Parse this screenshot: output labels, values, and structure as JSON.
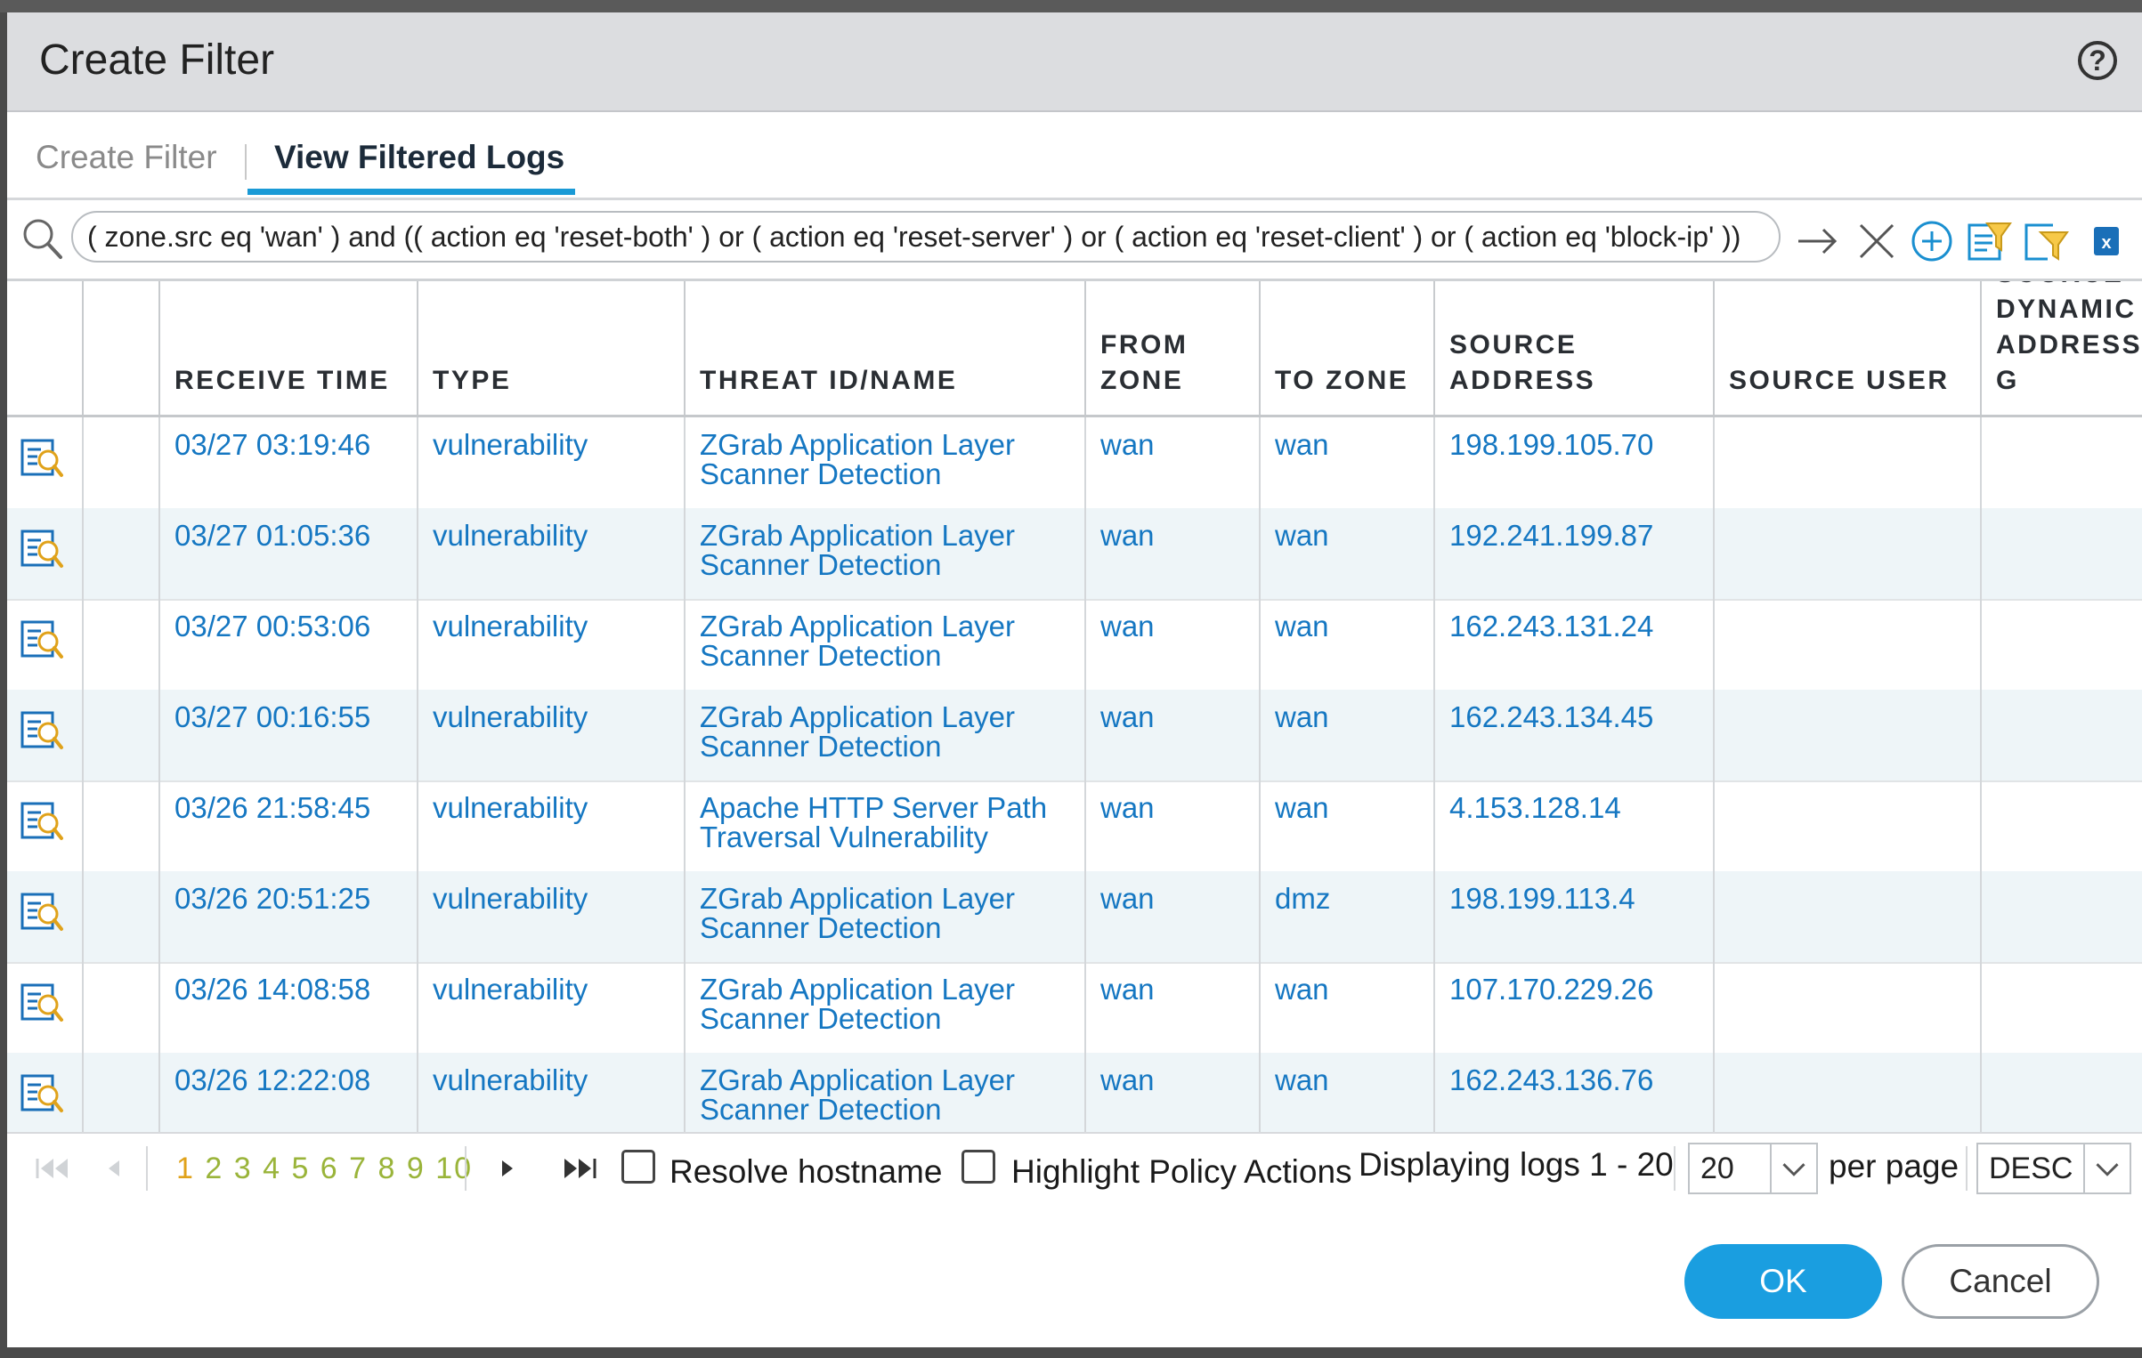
{
  "dialog": {
    "title": "Create Filter",
    "help_icon": "question-circle-icon"
  },
  "tabs": [
    {
      "label": "Create Filter",
      "active": false
    },
    {
      "label": "View Filtered Logs",
      "active": true
    }
  ],
  "search": {
    "filter_text": "( zone.src eq 'wan' )  and (( action eq 'reset-both' ) or ( action eq 'reset-server' ) or ( action eq 'reset-client' ) or ( action eq 'block-ip' ))",
    "icons": [
      "search-icon",
      "apply-filter-arrow-icon",
      "clear-filter-icon",
      "add-filter-icon",
      "save-filter-icon",
      "load-filter-icon",
      "export-excel-icon"
    ]
  },
  "table": {
    "columns": [
      {
        "label": ""
      },
      {
        "label": ""
      },
      {
        "label": "RECEIVE TIME"
      },
      {
        "label": "TYPE"
      },
      {
        "label": "THREAT ID/NAME"
      },
      {
        "label": "FROM\nZONE"
      },
      {
        "label": "TO ZONE"
      },
      {
        "label": "SOURCE ADDRESS"
      },
      {
        "label": "SOURCE USER"
      },
      {
        "label": "SOURCE\nDYNAMIC\nADDRESS G"
      }
    ],
    "rows": [
      {
        "time": "03/27 03:19:46",
        "type": "vulnerability",
        "threat_line1": "ZGrab Application Layer",
        "threat_line2": "Scanner Detection",
        "from_zone": "wan",
        "to_zone": "wan",
        "source_address": "198.199.105.70",
        "source_user": "",
        "dag": ""
      },
      {
        "time": "03/27 01:05:36",
        "type": "vulnerability",
        "threat_line1": "ZGrab Application Layer",
        "threat_line2": "Scanner Detection",
        "from_zone": "wan",
        "to_zone": "wan",
        "source_address": "192.241.199.87",
        "source_user": "",
        "dag": ""
      },
      {
        "time": "03/27 00:53:06",
        "type": "vulnerability",
        "threat_line1": "ZGrab Application Layer",
        "threat_line2": "Scanner Detection",
        "from_zone": "wan",
        "to_zone": "wan",
        "source_address": "162.243.131.24",
        "source_user": "",
        "dag": ""
      },
      {
        "time": "03/27 00:16:55",
        "type": "vulnerability",
        "threat_line1": "ZGrab Application Layer",
        "threat_line2": "Scanner Detection",
        "from_zone": "wan",
        "to_zone": "wan",
        "source_address": "162.243.134.45",
        "source_user": "",
        "dag": ""
      },
      {
        "time": "03/26 21:58:45",
        "type": "vulnerability",
        "threat_line1": "Apache HTTP Server Path",
        "threat_line2": "Traversal Vulnerability",
        "from_zone": "wan",
        "to_zone": "wan",
        "source_address": "4.153.128.14",
        "source_user": "",
        "dag": ""
      },
      {
        "time": "03/26 20:51:25",
        "type": "vulnerability",
        "threat_line1": "ZGrab Application Layer",
        "threat_line2": "Scanner Detection",
        "from_zone": "wan",
        "to_zone": "dmz",
        "source_address": "198.199.113.4",
        "source_user": "",
        "dag": ""
      },
      {
        "time": "03/26 14:08:58",
        "type": "vulnerability",
        "threat_line1": "ZGrab Application Layer",
        "threat_line2": "Scanner Detection",
        "from_zone": "wan",
        "to_zone": "wan",
        "source_address": "107.170.229.26",
        "source_user": "",
        "dag": ""
      },
      {
        "time": "03/26 12:22:08",
        "type": "vulnerability",
        "threat_line1": "ZGrab Application Layer",
        "threat_line2": "Scanner Detection",
        "from_zone": "wan",
        "to_zone": "wan",
        "source_address": "162.243.136.76",
        "source_user": "",
        "dag": ""
      }
    ]
  },
  "pager": {
    "current_page": "1",
    "other_pages": "2 3 4 5 6 7 8 9 10",
    "resolve_hostname_label": "Resolve hostname",
    "resolve_hostname_checked": false,
    "highlight_policy_label": "Highlight Policy Actions",
    "highlight_policy_checked": false,
    "displaying_text": "Displaying logs 1 - 20",
    "per_page_value": "20",
    "per_page_label": "per page",
    "sort_order": "DESC"
  },
  "buttons": {
    "ok": "OK",
    "cancel": "Cancel"
  },
  "colors": {
    "accent": "#1a9ad6",
    "link": "#1577c2",
    "ok_button": "#1a9ee0",
    "page_numbers": "#9ab43a",
    "current_page": "#e0a21a"
  }
}
